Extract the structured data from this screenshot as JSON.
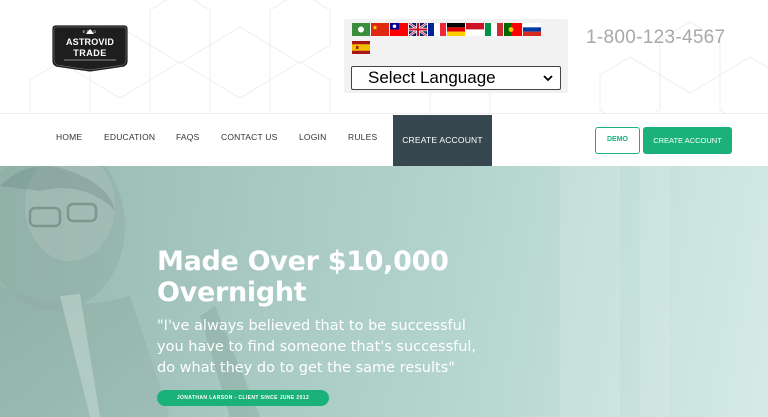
{
  "brand": {
    "estd": "ESTD",
    "line1": "ASTROVID",
    "line2": "TRADE"
  },
  "language": {
    "flags": [
      "arabic-flag-icon",
      "china-flag-icon",
      "taiwan-flag-icon",
      "uk-flag-icon",
      "france-flag-icon",
      "germany-flag-icon",
      "indonesia-flag-icon",
      "italy-flag-icon",
      "portugal-flag-icon",
      "russia-flag-icon",
      "spain-flag-icon"
    ],
    "select_value": "Select Language"
  },
  "phone": "1-800-123-4567",
  "nav": {
    "items": [
      "HOME",
      "EDUCATION",
      "FAQS",
      "CONTACT US",
      "LOGIN",
      "RULES"
    ],
    "cta": "CREATE ACCOUNT",
    "demo": "DEMO",
    "create": "CREATE ACCOUNT"
  },
  "hero": {
    "title_line1": "Made Over $10,000",
    "title_line2": "Overnight",
    "quote": "\"I've always believed that to be successful you have to find someone that's successful, do what they do to get the same results\"",
    "badge": "JONATHAN LARSON - CLIENT SINCE JUNE 2012"
  },
  "colors": {
    "accent": "#1ab17a",
    "nav_cta_bg": "#37474f",
    "phone": "#a8a8a8"
  }
}
